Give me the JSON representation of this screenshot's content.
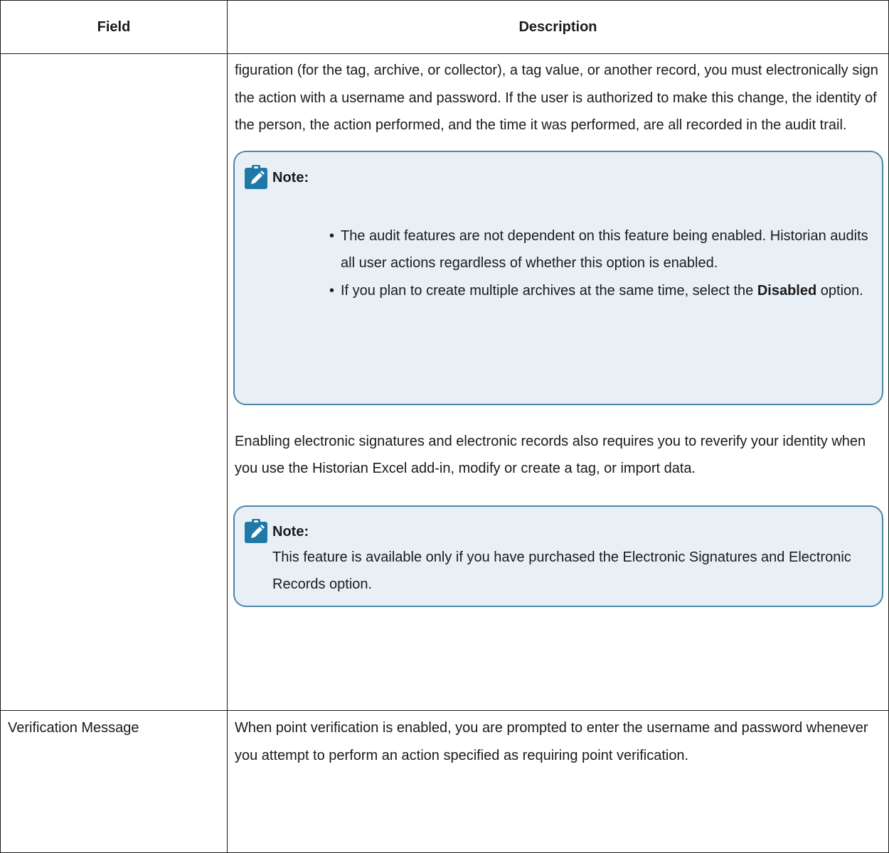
{
  "table": {
    "headers": {
      "field": "Field",
      "description": "Description"
    }
  },
  "row1": {
    "field": "",
    "paragraph1": "figuration (for the tag, archive, or collector), a tag value, or another record, you must electronically sign the action with a username and password. If the user is authorized to make this change, the identity of the person, the action per­formed, and the time it was performed, are all recorded in the audit trail.",
    "note1": {
      "icon": "note-pencil-icon",
      "title": "Note:",
      "items": [
        {
          "text": "The audit features are not dependent on this feature being en­abled. Historian audits all user actions regardless of whether this option is enabled."
        },
        {
          "before": "If you plan to create multiple archives at the same time, select the ",
          "bold": "Disabled",
          "after": " option."
        }
      ]
    },
    "paragraph2": "Enabling electronic signatures and electronic records also requires you to reverify your identity when you use the Historian Excel add-in, modify or cre­ate a tag, or import data.",
    "note2": {
      "icon": "note-pencil-icon",
      "title": "Note:",
      "body": "This feature is available only if you have purchased the Electronic Signatures and Electronic Records option."
    }
  },
  "row2": {
    "field": "Verification Message",
    "description": "When point verification is enabled, you are prompted to enter the username and password whenever you attempt to perform an action specified as requir­ing point verification."
  },
  "colors": {
    "note_border": "#4a87a8",
    "note_background": "#e9f0f5",
    "icon": "#1f79a6"
  }
}
